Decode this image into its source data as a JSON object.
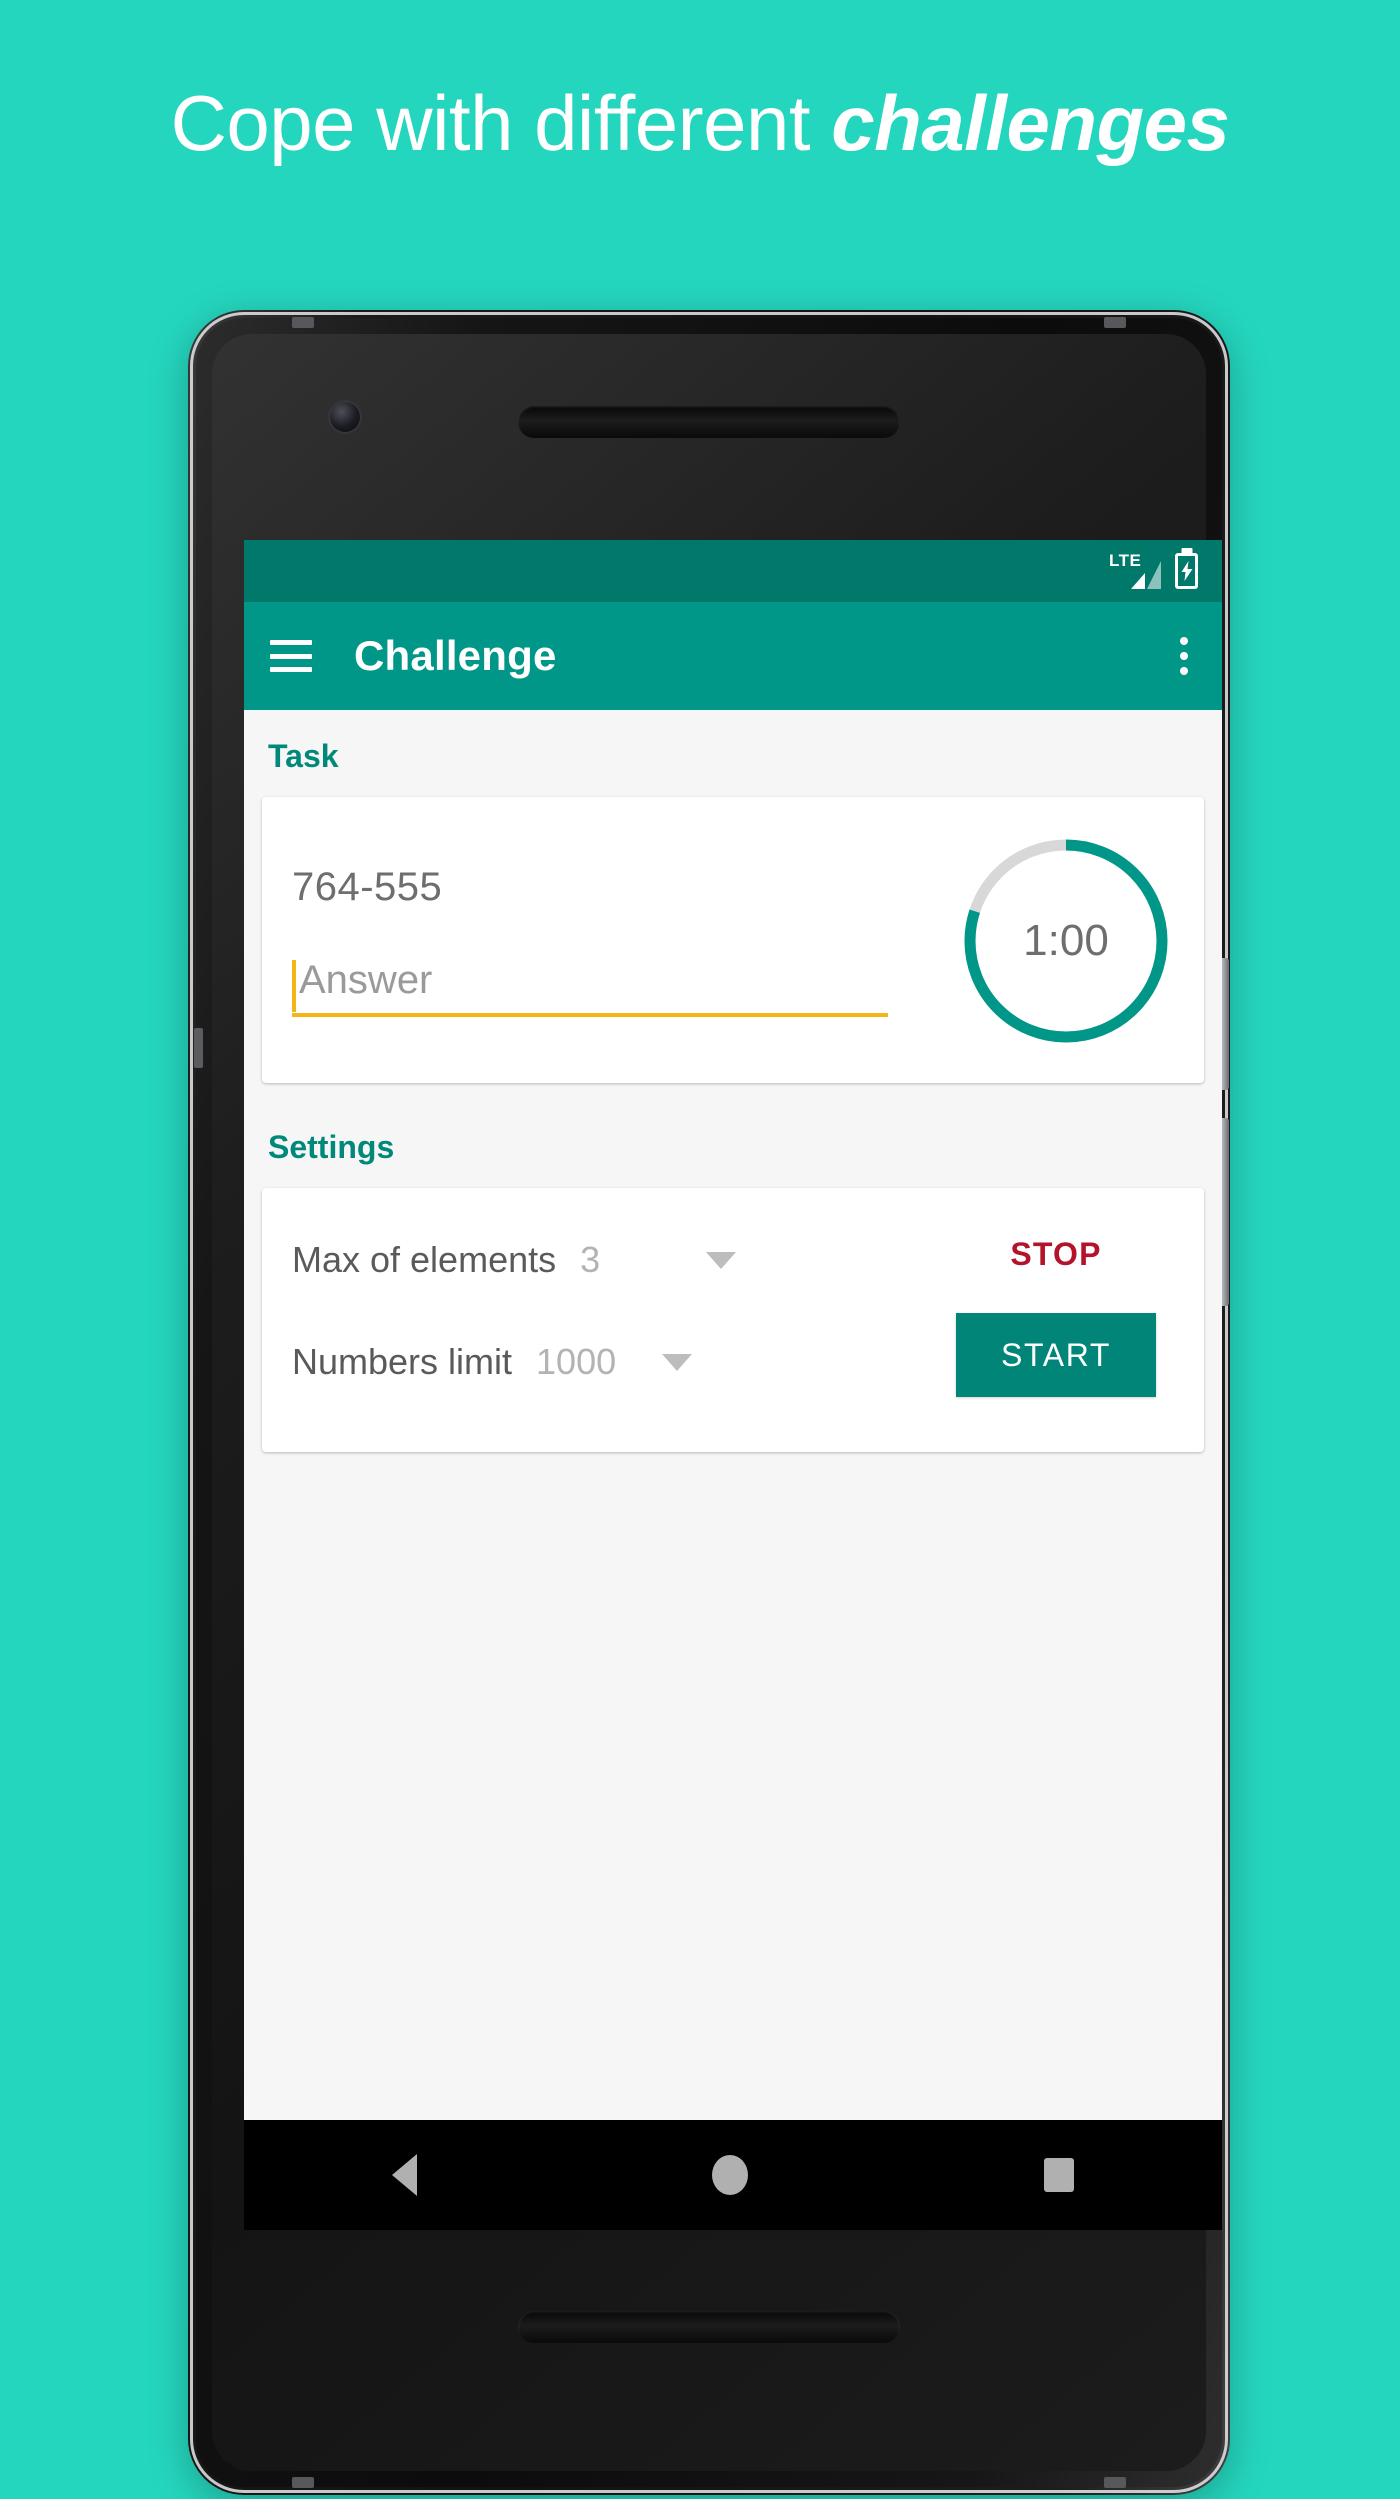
{
  "promo": {
    "headline_plain": "Cope with different ",
    "headline_emphasis": "challenges",
    "background_color": "#25D6BE"
  },
  "device": {
    "frame_label": "android-phone-frame",
    "camera_label": "front-camera",
    "speaker_label": "earpiece-speaker"
  },
  "app": {
    "status_bar": {
      "network_label": "LTE",
      "signal_icon": "signal-bars-icon",
      "battery_icon": "battery-charging-icon",
      "background_color": "#00796B"
    },
    "app_bar": {
      "menu_icon": "hamburger-menu-icon",
      "title": "Challenge",
      "overflow_icon": "overflow-menu-icon",
      "background_color": "#009688"
    },
    "task_section": {
      "label": "Task",
      "expression": "764-555",
      "answer_placeholder": "Answer",
      "answer_value": "",
      "underline_color": "#F5B517",
      "timer": {
        "display": "1:00",
        "progress_percent": 80,
        "track_color": "#D8D8D8",
        "arc_color": "#009688"
      }
    },
    "settings_section": {
      "label": "Settings",
      "rows": [
        {
          "label": "Max of elements",
          "value": "3",
          "dropdown_icon": "chevron-down-icon"
        },
        {
          "label": "Numbers limit",
          "value": "1000",
          "dropdown_icon": "chevron-down-icon"
        }
      ],
      "stop_label": "STOP",
      "stop_color": "#B3142B",
      "start_label": "START",
      "start_color": "#008578"
    },
    "nav_bar": {
      "back_icon": "back-triangle-icon",
      "home_icon": "home-circle-icon",
      "recents_icon": "recents-square-icon",
      "background_color": "#000000"
    }
  }
}
